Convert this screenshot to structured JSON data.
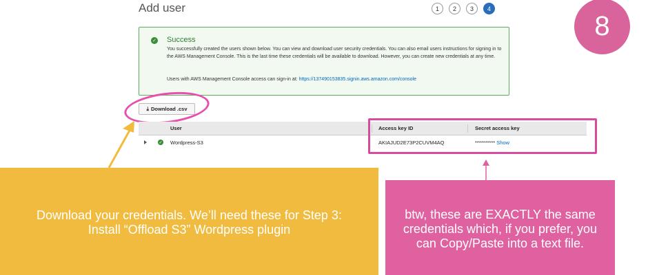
{
  "page": {
    "title": "Add user",
    "steps": [
      "1",
      "2",
      "3",
      "4"
    ],
    "active_step": "4"
  },
  "badge": {
    "text": "8"
  },
  "success": {
    "heading": "Success",
    "message": "You successfully created the users shown below. You can view and download user security credentials. You can also email users instructions for signing in to the AWS Management Console. This is the last time these credentials will be available to download. However, you can create new credentials at any time.",
    "signin_prefix": "Users with AWS Management Console access can sign-in at:",
    "signin_url": "https://137490153835.signin.aws.amazon.com/console"
  },
  "download": {
    "label": "Download .csv",
    "icon": "download-icon"
  },
  "table": {
    "headers": {
      "user": "User",
      "access_key_id": "Access key ID",
      "secret_access_key": "Secret access key"
    },
    "rows": [
      {
        "user": "Wordpress-S3",
        "access_key_id": "AKIAJUD2E73P2CUVM4AQ",
        "secret_masked": "**********",
        "secret_action": "Show"
      }
    ]
  },
  "annotations": {
    "yellow_text": "Download your credentials. We’ll need these for Step 3: Install “Offload S3” Wordpress plugin",
    "pink_text": "btw, these are EXACTLY the same credentials which, if you prefer, you can Copy/Paste into a text file."
  },
  "colors": {
    "accent_pink": "#e0619f",
    "highlight_pink": "#e84fad",
    "callout_yellow": "#f0bb3e",
    "success_green": "#3c8c3c",
    "active_step_blue": "#2a6ebb",
    "link_blue": "#0066c0"
  }
}
